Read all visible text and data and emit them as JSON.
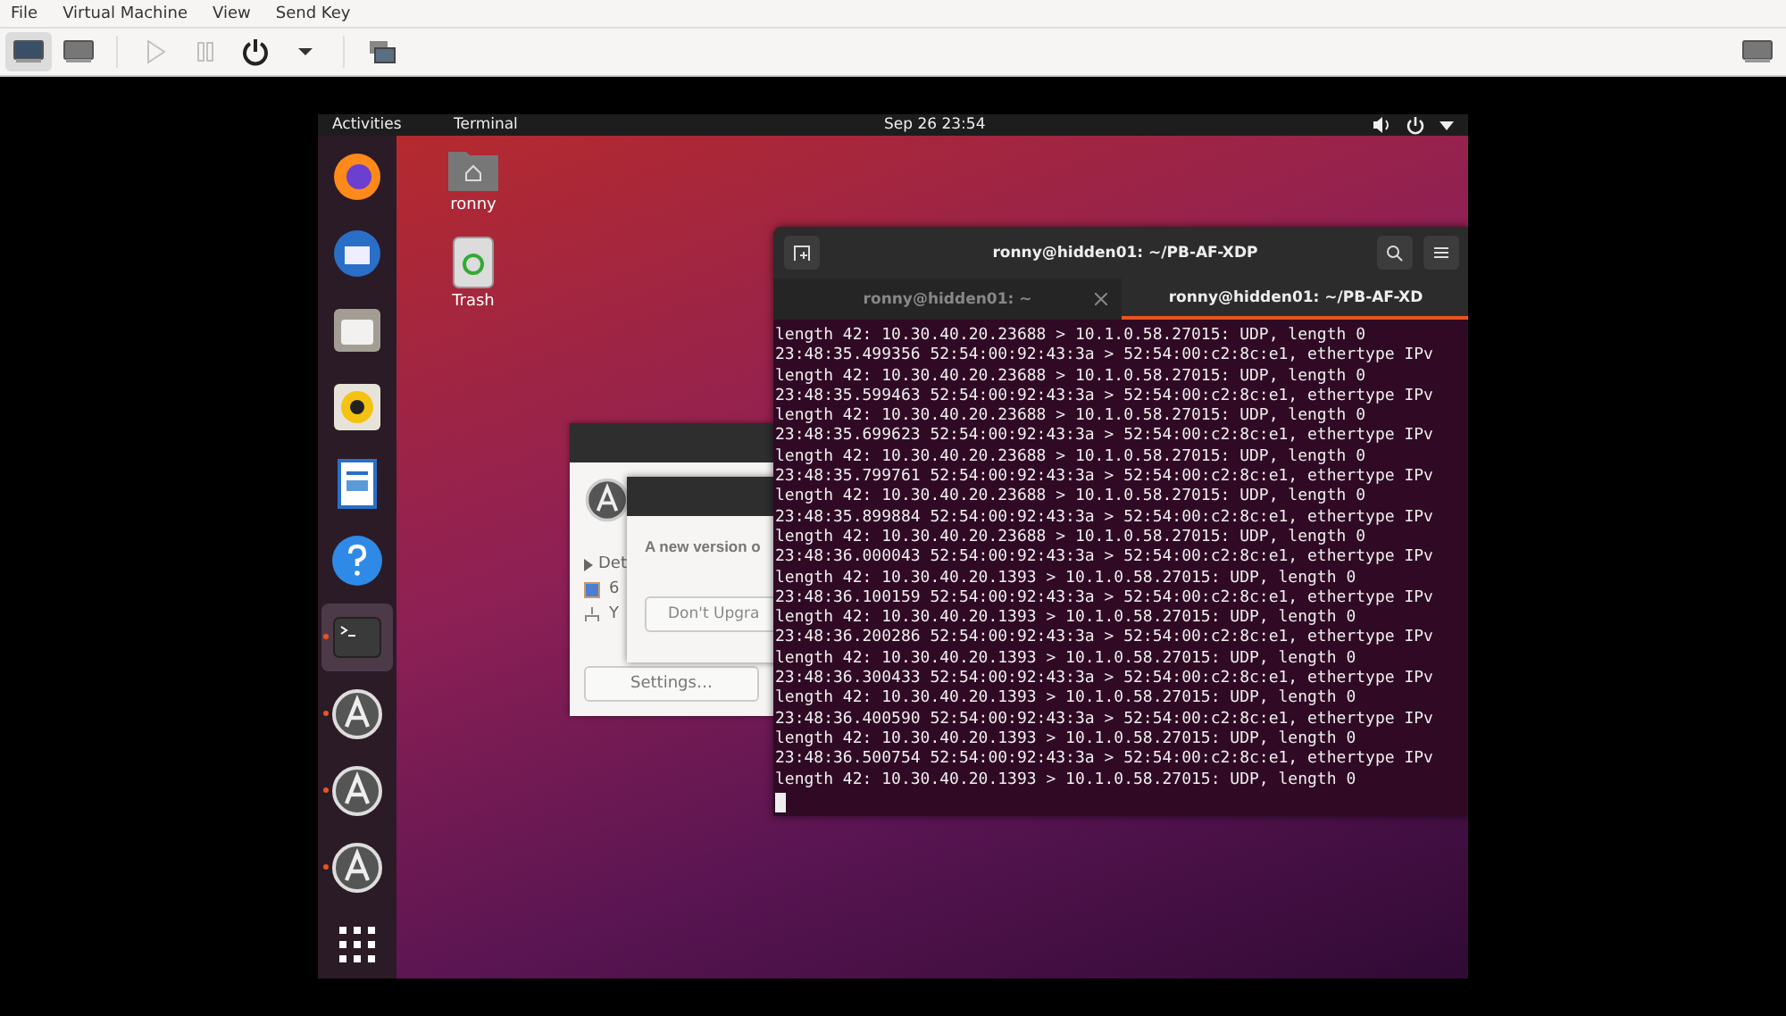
{
  "menu": [
    "File",
    "Virtual Machine",
    "View",
    "Send Key"
  ],
  "toolbar": [
    {
      "kind": "console",
      "selected": true,
      "disabled": false
    },
    {
      "kind": "details",
      "selected": false,
      "disabled": false
    },
    {
      "kind": "run",
      "selected": false,
      "disabled": true
    },
    {
      "kind": "pause",
      "selected": false,
      "disabled": true
    },
    {
      "kind": "power",
      "selected": false,
      "disabled": false
    },
    {
      "kind": "caret",
      "selected": false,
      "disabled": false
    },
    {
      "kind": "snapshots",
      "selected": false,
      "disabled": false
    },
    {
      "kind": "fullscreen",
      "selected": false,
      "disabled": false
    }
  ],
  "top_bar": {
    "activities": "Activities",
    "app_menu": "Terminal",
    "clock": "Sep 26  23:54"
  },
  "dock": [
    {
      "kind": "firefox",
      "running": false,
      "selected": false
    },
    {
      "kind": "mail",
      "running": false,
      "selected": false
    },
    {
      "kind": "files",
      "running": false,
      "selected": false
    },
    {
      "kind": "music",
      "running": false,
      "selected": false
    },
    {
      "kind": "writer",
      "running": false,
      "selected": false
    },
    {
      "kind": "help",
      "running": false,
      "selected": false
    },
    {
      "kind": "terminal",
      "running": true,
      "selected": true
    },
    {
      "kind": "updater",
      "running": true,
      "selected": false
    },
    {
      "kind": "updater",
      "running": true,
      "selected": false
    },
    {
      "kind": "updater",
      "running": true,
      "selected": false
    },
    {
      "kind": "apps",
      "running": false,
      "selected": false
    }
  ],
  "desktop_icons": [
    {
      "kind": "home",
      "label": "ronny"
    },
    {
      "kind": "trash",
      "label": "Trash"
    }
  ],
  "update_dialog": {
    "details": "Det",
    "line_1": "6",
    "line_2": "Y",
    "settings_button": "Settings…"
  },
  "upgrade_dialog": {
    "message": "A new version o",
    "button": "Don't Upgra"
  },
  "terminal": {
    "title": "ronny@hidden01: ~/PB-AF-XDP",
    "tabs": [
      {
        "label": "ronny@hidden01: ~",
        "selected": false
      },
      {
        "label": "ronny@hidden01: ~/PB-AF-XD",
        "selected": true
      }
    ],
    "lines": [
      "length 42: 10.30.40.20.23688 > 10.1.0.58.27015: UDP, length 0",
      "23:48:35.499356 52:54:00:92:43:3a > 52:54:00:c2:8c:e1, ethertype IPv",
      "length 42: 10.30.40.20.23688 > 10.1.0.58.27015: UDP, length 0",
      "23:48:35.599463 52:54:00:92:43:3a > 52:54:00:c2:8c:e1, ethertype IPv",
      "length 42: 10.30.40.20.23688 > 10.1.0.58.27015: UDP, length 0",
      "23:48:35.699623 52:54:00:92:43:3a > 52:54:00:c2:8c:e1, ethertype IPv",
      "length 42: 10.30.40.20.23688 > 10.1.0.58.27015: UDP, length 0",
      "23:48:35.799761 52:54:00:92:43:3a > 52:54:00:c2:8c:e1, ethertype IPv",
      "length 42: 10.30.40.20.23688 > 10.1.0.58.27015: UDP, length 0",
      "23:48:35.899884 52:54:00:92:43:3a > 52:54:00:c2:8c:e1, ethertype IPv",
      "length 42: 10.30.40.20.23688 > 10.1.0.58.27015: UDP, length 0",
      "23:48:36.000043 52:54:00:92:43:3a > 52:54:00:c2:8c:e1, ethertype IPv",
      "length 42: 10.30.40.20.1393 > 10.1.0.58.27015: UDP, length 0",
      "23:48:36.100159 52:54:00:92:43:3a > 52:54:00:c2:8c:e1, ethertype IPv",
      "length 42: 10.30.40.20.1393 > 10.1.0.58.27015: UDP, length 0",
      "23:48:36.200286 52:54:00:92:43:3a > 52:54:00:c2:8c:e1, ethertype IPv",
      "length 42: 10.30.40.20.1393 > 10.1.0.58.27015: UDP, length 0",
      "23:48:36.300433 52:54:00:92:43:3a > 52:54:00:c2:8c:e1, ethertype IPv",
      "length 42: 10.30.40.20.1393 > 10.1.0.58.27015: UDP, length 0",
      "23:48:36.400590 52:54:00:92:43:3a > 52:54:00:c2:8c:e1, ethertype IPv",
      "length 42: 10.30.40.20.1393 > 10.1.0.58.27015: UDP, length 0",
      "23:48:36.500754 52:54:00:92:43:3a > 52:54:00:c2:8c:e1, ethertype IPv",
      "length 42: 10.30.40.20.1393 > 10.1.0.58.27015: UDP, length 0"
    ]
  }
}
